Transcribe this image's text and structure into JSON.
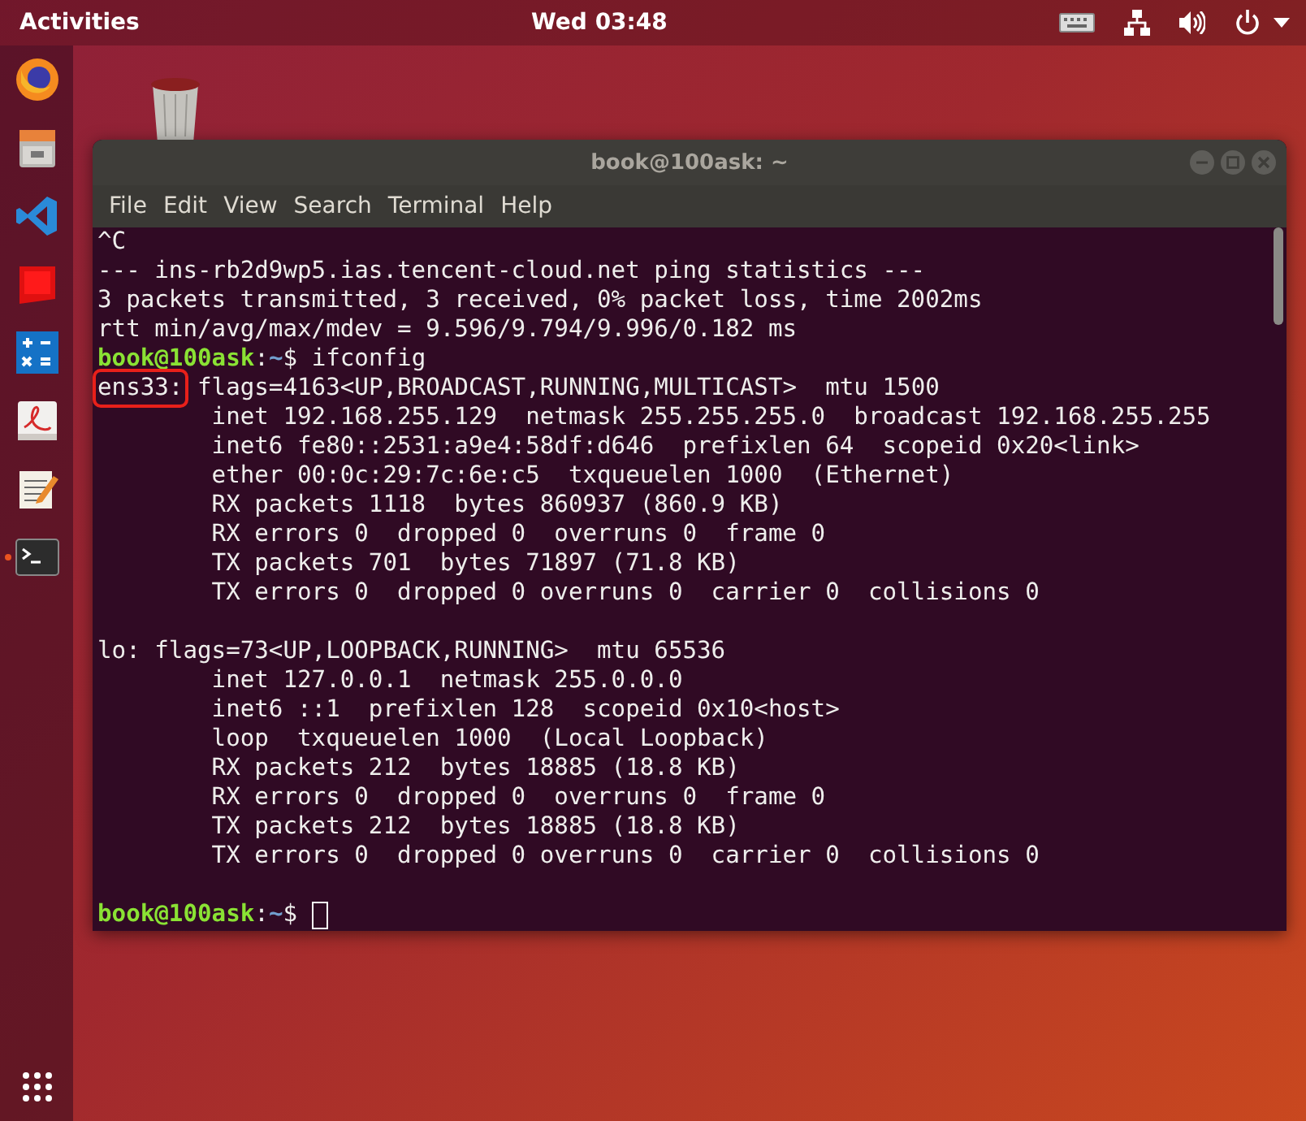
{
  "top_bar": {
    "activities": "Activities",
    "clock": "Wed 03:48"
  },
  "dock": [
    {
      "kind": "browser",
      "running": false
    },
    {
      "kind": "files",
      "running": false
    },
    {
      "kind": "code-editor",
      "running": false
    },
    {
      "kind": "office",
      "running": false
    },
    {
      "kind": "calculator",
      "running": false
    },
    {
      "kind": "reader",
      "running": false
    },
    {
      "kind": "notes",
      "running": false
    },
    {
      "kind": "terminal",
      "running": true
    }
  ],
  "window": {
    "title": "book@100ask: ~",
    "menu": [
      "File",
      "Edit",
      "View",
      "Search",
      "Terminal",
      "Help"
    ],
    "lines": [
      {
        "kind": "output",
        "text": "^C"
      },
      {
        "kind": "output",
        "text": "--- ins-rb2d9wp5.ias.tencent-cloud.net ping statistics ---"
      },
      {
        "kind": "output",
        "text": "3 packets transmitted, 3 received, 0% packet loss, time 2002ms"
      },
      {
        "kind": "output",
        "text": "rtt min/avg/max/mdev = 9.596/9.794/9.996/0.182 ms"
      },
      {
        "kind": "prompt",
        "user": "book@100ask",
        "separator": ":",
        "path": "~",
        "symbol": "$",
        "command": "ifconfig",
        "cursor": false
      },
      {
        "kind": "marked",
        "marked": "ens33:",
        "text": " flags=4163<UP,BROADCAST,RUNNING,MULTICAST>  mtu 1500"
      },
      {
        "kind": "output",
        "text": "        inet 192.168.255.129  netmask 255.255.255.0  broadcast 192.168.255.255"
      },
      {
        "kind": "output",
        "text": "        inet6 fe80::2531:a9e4:58df:d646  prefixlen 64  scopeid 0x20<link>"
      },
      {
        "kind": "output",
        "text": "        ether 00:0c:29:7c:6e:c5  txqueuelen 1000  (Ethernet)"
      },
      {
        "kind": "output",
        "text": "        RX packets 1118  bytes 860937 (860.9 KB)"
      },
      {
        "kind": "output",
        "text": "        RX errors 0  dropped 0  overruns 0  frame 0"
      },
      {
        "kind": "output",
        "text": "        TX packets 701  bytes 71897 (71.8 KB)"
      },
      {
        "kind": "output",
        "text": "        TX errors 0  dropped 0 overruns 0  carrier 0  collisions 0"
      },
      {
        "kind": "blank"
      },
      {
        "kind": "output",
        "text": "lo: flags=73<UP,LOOPBACK,RUNNING>  mtu 65536"
      },
      {
        "kind": "output",
        "text": "        inet 127.0.0.1  netmask 255.0.0.0"
      },
      {
        "kind": "output",
        "text": "        inet6 ::1  prefixlen 128  scopeid 0x10<host>"
      },
      {
        "kind": "output",
        "text": "        loop  txqueuelen 1000  (Local Loopback)"
      },
      {
        "kind": "output",
        "text": "        RX packets 212  bytes 18885 (18.8 KB)"
      },
      {
        "kind": "output",
        "text": "        RX errors 0  dropped 0  overruns 0  frame 0"
      },
      {
        "kind": "output",
        "text": "        TX packets 212  bytes 18885 (18.8 KB)"
      },
      {
        "kind": "output",
        "text": "        TX errors 0  dropped 0 overruns 0  carrier 0  collisions 0"
      },
      {
        "kind": "blank"
      },
      {
        "kind": "prompt",
        "user": "book@100ask",
        "separator": ":",
        "path": "~",
        "symbol": "$",
        "cursor": true
      }
    ]
  }
}
